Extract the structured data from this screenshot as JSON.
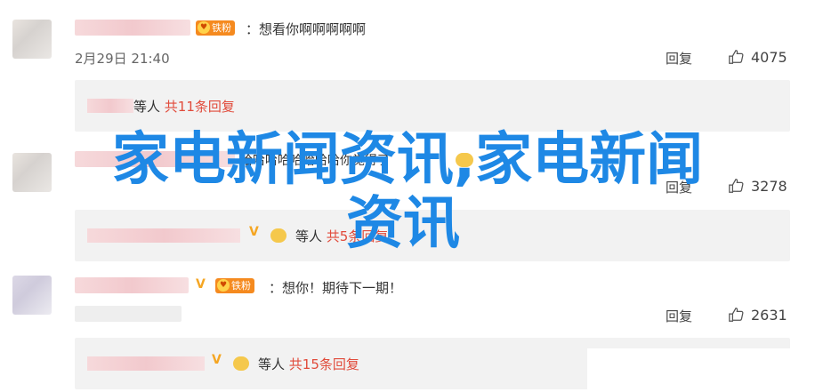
{
  "comments": [
    {
      "text": "：想看你啊啊啊啊啊",
      "time": "2月29日 21:40",
      "reply_label": "回复",
      "likes": "4075",
      "replies": {
        "prefix": "等人",
        "link": "共11条回复"
      }
    },
    {
      "text": "哈哈哈哈哈哈哈哈你觉得了",
      "reply_label": "回复",
      "likes": "3278",
      "replies": {
        "prefix": "等人",
        "link": "共5条回复"
      }
    },
    {
      "text": "：想你！期待下一期！",
      "reply_label": "回复",
      "likes": "2631",
      "replies": {
        "prefix": "等人",
        "link": "共15条回复"
      }
    }
  ],
  "badges": {
    "fan": "铁粉",
    "verified": "V"
  },
  "overlay": {
    "line1": "家电新闻资讯,家电新闻",
    "line2": "资讯"
  },
  "colors": {
    "accent_red": "#e14b3b",
    "overlay_blue": "#1e88e5",
    "badge_orange": "#f58a1f"
  }
}
